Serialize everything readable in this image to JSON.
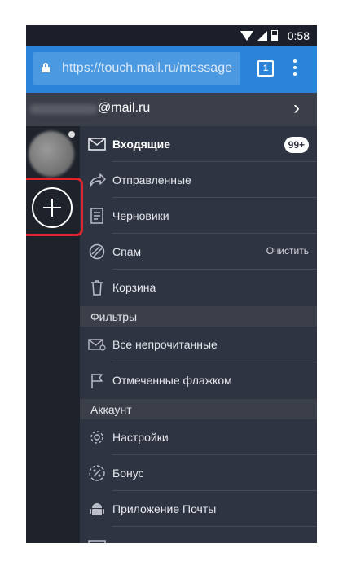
{
  "status_bar": {
    "time": "0:58"
  },
  "browser": {
    "url": "https://touch.mail.ru/message",
    "tab_count": "1"
  },
  "account": {
    "domain": "@mail.ru"
  },
  "menu": {
    "folders": [
      {
        "label": "Входящие",
        "icon": "inbox-icon",
        "badge": "99+"
      },
      {
        "label": "Отправленные",
        "icon": "sent-icon"
      },
      {
        "label": "Черновики",
        "icon": "drafts-icon"
      },
      {
        "label": "Спам",
        "icon": "spam-icon",
        "action": "Очистить"
      },
      {
        "label": "Корзина",
        "icon": "trash-icon"
      }
    ],
    "filters_header": "Фильтры",
    "filters": [
      {
        "label": "Все непрочитанные",
        "icon": "unread-icon"
      },
      {
        "label": "Отмеченные флажком",
        "icon": "flag-icon"
      }
    ],
    "account_header": "Аккаунт",
    "account_items": [
      {
        "label": "Настройки",
        "icon": "settings-gear-icon"
      },
      {
        "label": "Бонус",
        "icon": "bonus-percent-icon"
      },
      {
        "label": "Приложение Почты",
        "icon": "android-icon"
      }
    ]
  },
  "colors": {
    "browser_bar": "#2c84d8",
    "menu_bg": "#2f3442",
    "rail_bg": "#1d222b",
    "highlight": "#e0242b"
  }
}
